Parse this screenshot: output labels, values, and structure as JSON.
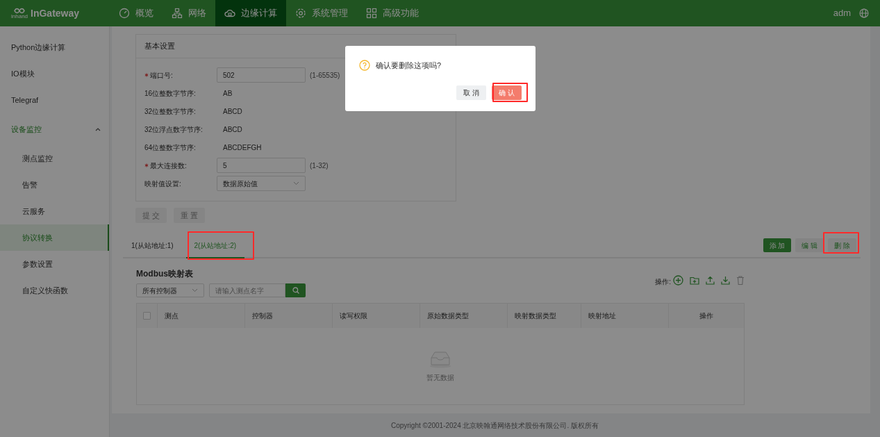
{
  "header": {
    "logo_small": "inhand",
    "logo": "InGateway",
    "nav": [
      {
        "label": "概览",
        "selected": false
      },
      {
        "label": "网络",
        "selected": false
      },
      {
        "label": "边缘计算",
        "selected": true
      },
      {
        "label": "系统管理",
        "selected": false
      },
      {
        "label": "高级功能",
        "selected": false
      }
    ],
    "user": "adm"
  },
  "sidebar": {
    "items": [
      {
        "label": "Python边缘计算",
        "selected": false
      },
      {
        "label": "IO模块",
        "selected": false
      },
      {
        "label": "Telegraf",
        "selected": false
      },
      {
        "label": "设备监控",
        "selected": false,
        "expanded": true,
        "children": [
          {
            "label": "测点监控",
            "selected": false
          },
          {
            "label": "告警",
            "selected": false
          },
          {
            "label": "云服务",
            "selected": false
          },
          {
            "label": "协议转换",
            "selected": true
          },
          {
            "label": "参数设置",
            "selected": false
          },
          {
            "label": "自定义快函数",
            "selected": false
          }
        ]
      }
    ]
  },
  "basic_settings": {
    "title": "基本设置",
    "fields": [
      {
        "kind": "input",
        "label": "端口号:",
        "required": true,
        "value": "502",
        "hint": "(1-65535)"
      },
      {
        "kind": "text",
        "label": "16位整数字节序:",
        "required": false,
        "value": "AB"
      },
      {
        "kind": "text",
        "label": "32位整数字节序:",
        "required": false,
        "value": "ABCD"
      },
      {
        "kind": "text",
        "label": "32位浮点数字节序:",
        "required": false,
        "value": "ABCD"
      },
      {
        "kind": "text",
        "label": "64位整数字节序:",
        "required": false,
        "value": "ABCDEFGH"
      },
      {
        "kind": "input",
        "label": "最大连接数:",
        "required": true,
        "value": "5",
        "hint": "(1-32)"
      },
      {
        "kind": "select",
        "label": "映射值设置:",
        "required": false,
        "value": "数据原始值"
      }
    ],
    "buttons": [
      {
        "label": "提 交",
        "disabled": true
      },
      {
        "label": "重 置",
        "disabled": true
      }
    ]
  },
  "slave_tabs": [
    {
      "label": "1(从站地址:1)",
      "selected": false
    },
    {
      "label": "2(从站地址:2)",
      "selected": true
    }
  ],
  "tab_buttons": [
    {
      "label": "添 加",
      "kind": "primary"
    },
    {
      "label": "编 辑",
      "kind": "default"
    },
    {
      "label": "删 除",
      "kind": "default"
    }
  ],
  "mapping": {
    "title": "Modbus映射表",
    "filter": "所有控制器",
    "search_placeholder": "请输入测点名字",
    "select_all_checked": false,
    "actions_label": "操作:",
    "columns": [
      "测点",
      "控制器",
      "读写权限",
      "原始数据类型",
      "映射数据类型",
      "映射地址",
      "操作"
    ],
    "empty": "暂无数据"
  },
  "footer": "Copyright ©2001-2024 北京映翰通网络技术股份有限公司. 版权所有",
  "dialog": {
    "message": "确认要删除这项吗?",
    "buttons": [
      {
        "label": "取 消",
        "kind": "default"
      },
      {
        "label": "确 认",
        "kind": "primary"
      }
    ]
  }
}
